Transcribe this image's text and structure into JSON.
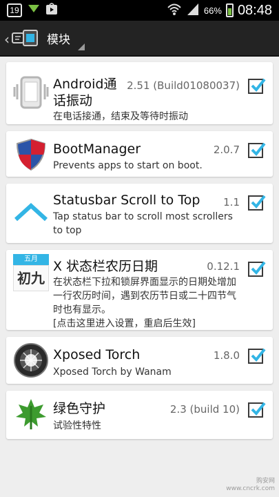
{
  "status": {
    "notif": "19",
    "battery_pct": "66%",
    "time": "08:48"
  },
  "actionbar": {
    "title": "模块"
  },
  "modules": [
    {
      "name": "Android通\n话振动",
      "version": "2.51 (Build01080037)",
      "desc": "在电话接通，结束及等待时振动",
      "checked": true,
      "icon": "phone-vibrate-icon"
    },
    {
      "name": "BootManager",
      "version": "2.0.7",
      "desc": "Prevents apps to start on boot.",
      "checked": true,
      "icon": "shield-icon"
    },
    {
      "name": "Statusbar Scroll to Top",
      "version": "1.1",
      "desc": "Tap status bar to scroll most scrollers to top",
      "checked": true,
      "icon": "chevron-up-icon"
    },
    {
      "name": "X 状态栏农历日期",
      "version": "0.12.1",
      "desc": "在状态栏下拉和锁屏界面显示的日期处增加一行农历时间，遇到农历节日或二十四节气时也有显示。\n[点击这里进入设置，重启后生效]",
      "checked": true,
      "icon": "lunar-calendar-icon",
      "cal_month": "五月",
      "cal_day": "初九"
    },
    {
      "name": "Xposed Torch",
      "version": "1.8.0",
      "desc": "Xposed Torch by Wanam",
      "checked": true,
      "icon": "torch-icon"
    },
    {
      "name": "绿色守护",
      "version": "2.3 (build 10)",
      "desc": "试验性特性",
      "checked": true,
      "icon": "green-leaf-icon"
    }
  ],
  "watermark": {
    "line1": "购安网",
    "line2": "www.cncrk.com"
  },
  "colors": {
    "accent": "#33b5e5",
    "actionbar": "#232323",
    "background": "#eeeeee"
  }
}
